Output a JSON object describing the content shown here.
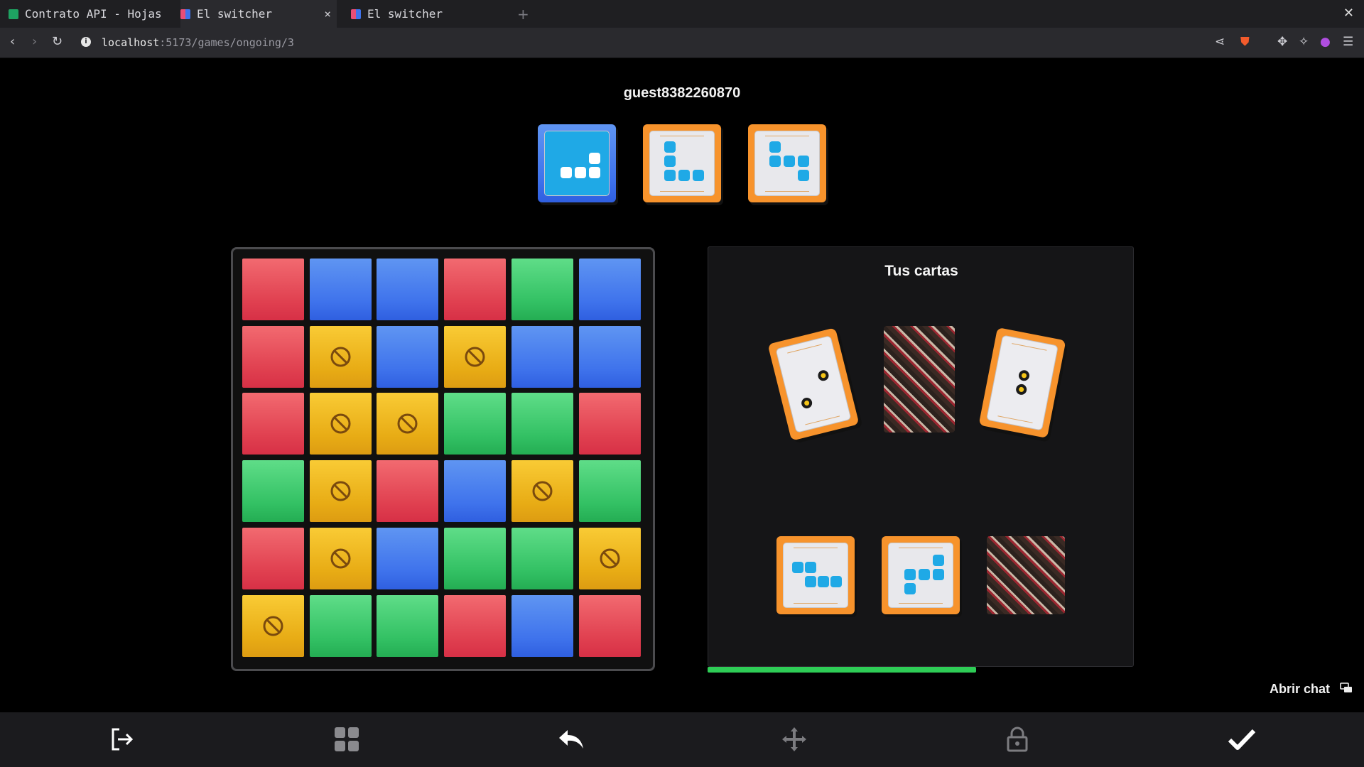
{
  "browser": {
    "tabs": [
      {
        "title": "Contrato API - Hojas",
        "favicon_color": "#1ea362",
        "active": false
      },
      {
        "title": "El switcher",
        "favicon_color": "#e94e77",
        "active": true
      },
      {
        "title": "El switcher",
        "favicon_color": "#e94e77",
        "active": false
      }
    ],
    "url_host": "localhost",
    "url_path": ":5173/games/ongoing/3",
    "new_tab_symbol": "+",
    "close_symbol": "×"
  },
  "game": {
    "opponent_name": "guest8382260870",
    "panel_title": "Tus cartas",
    "chat_label": "Abrir chat",
    "turn_progress": 0.63,
    "board": [
      [
        "red",
        "blue",
        "blue",
        "red",
        "green",
        "blue"
      ],
      [
        "red",
        "yellow",
        "blue",
        "yellow",
        "blue",
        "blue"
      ],
      [
        "red",
        "yellow",
        "yellow",
        "green",
        "green",
        "red"
      ],
      [
        "green",
        "yellow",
        "red",
        "blue",
        "yellow",
        "green"
      ],
      [
        "red",
        "yellow",
        "blue",
        "green",
        "green",
        "yellow"
      ],
      [
        "yellow",
        "green",
        "green",
        "red",
        "blue",
        "red"
      ]
    ],
    "blocked_color": "yellow",
    "colors": {
      "red": "#e04050",
      "blue": "#3f73ec",
      "green": "#33c164",
      "yellow": "#e8ac15",
      "card_orange": "#f7932c",
      "figure_blue": "#1fa9e6",
      "progress": "#2ecc56"
    },
    "opponent_figure_cards": [
      "figure-l-tromino-blocked",
      "figure-l-pentomino",
      "figure-s-pentomino"
    ],
    "my_movement_cards": [
      "movement-diagonal-card",
      "face-down-card",
      "movement-vertical-card"
    ],
    "my_figure_cards": [
      "figure-z-card",
      "figure-t-card",
      "face-down-card"
    ]
  },
  "toolbar": {
    "icons": [
      "leave-game-icon",
      "board-grid-icon",
      "undo-icon",
      "move-icon",
      "lock-icon",
      "confirm-icon"
    ]
  }
}
